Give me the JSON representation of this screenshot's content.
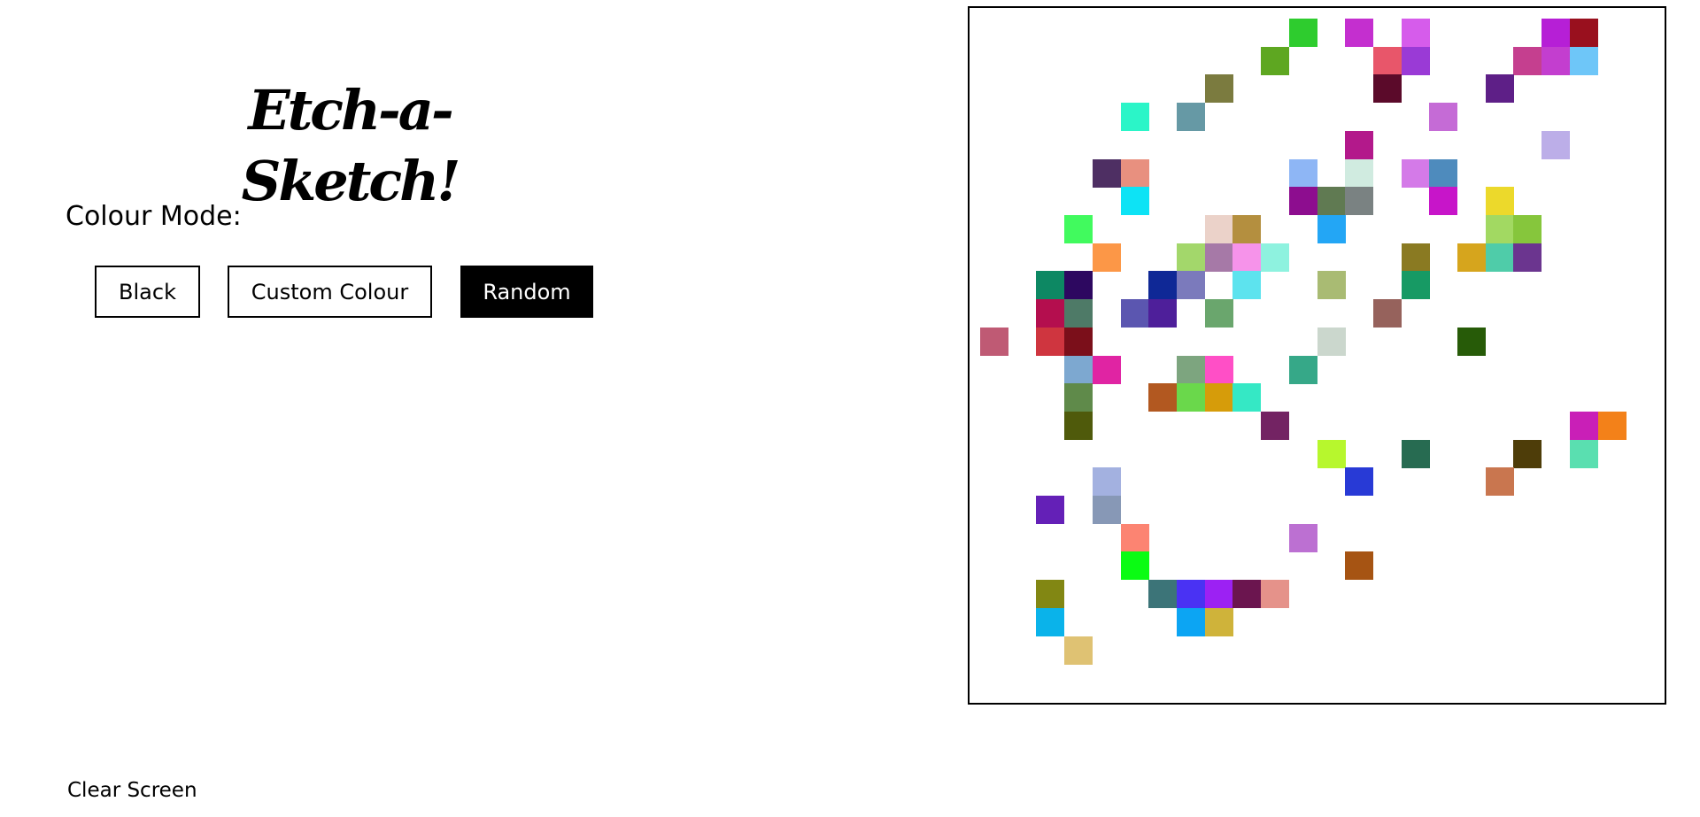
{
  "title": "Etch-a-Sketch!",
  "colour_mode": {
    "label": "Colour Mode:",
    "buttons": {
      "black": "Black",
      "custom": "Custom Colour",
      "random": "Random"
    },
    "selected": "Random"
  },
  "clear_label": "Clear Screen",
  "grid": {
    "columns": 24,
    "rows": 24,
    "filled_cells": [
      {
        "col": 11,
        "row": 0,
        "color": "#2ecc2e"
      },
      {
        "col": 13,
        "row": 0,
        "color": "#c42fcf"
      },
      {
        "col": 15,
        "row": 0,
        "color": "#d65ceb"
      },
      {
        "col": 20,
        "row": 0,
        "color": "#b61fd6"
      },
      {
        "col": 21,
        "row": 0,
        "color": "#99101e"
      },
      {
        "col": 10,
        "row": 1,
        "color": "#5ea721"
      },
      {
        "col": 14,
        "row": 1,
        "color": "#e8566a"
      },
      {
        "col": 15,
        "row": 1,
        "color": "#9a3ad6"
      },
      {
        "col": 19,
        "row": 1,
        "color": "#c53f8f"
      },
      {
        "col": 20,
        "row": 1,
        "color": "#c33ecf"
      },
      {
        "col": 21,
        "row": 1,
        "color": "#6ec6f8"
      },
      {
        "col": 8,
        "row": 2,
        "color": "#7b7b3f"
      },
      {
        "col": 14,
        "row": 2,
        "color": "#5b0a2a"
      },
      {
        "col": 18,
        "row": 2,
        "color": "#5e1f87"
      },
      {
        "col": 5,
        "row": 3,
        "color": "#2bf5c8"
      },
      {
        "col": 7,
        "row": 3,
        "color": "#6699a5"
      },
      {
        "col": 16,
        "row": 3,
        "color": "#c56bd6"
      },
      {
        "col": 13,
        "row": 4,
        "color": "#b3198b"
      },
      {
        "col": 20,
        "row": 4,
        "color": "#bcaee8"
      },
      {
        "col": 4,
        "row": 5,
        "color": "#4e2f63"
      },
      {
        "col": 5,
        "row": 5,
        "color": "#e8907f"
      },
      {
        "col": 11,
        "row": 5,
        "color": "#8eb6f5"
      },
      {
        "col": 13,
        "row": 5,
        "color": "#d0ebe0"
      },
      {
        "col": 15,
        "row": 5,
        "color": "#d47ae8"
      },
      {
        "col": 16,
        "row": 5,
        "color": "#4e8bbd"
      },
      {
        "col": 5,
        "row": 6,
        "color": "#0de3f5"
      },
      {
        "col": 11,
        "row": 6,
        "color": "#8d0d8f"
      },
      {
        "col": 12,
        "row": 6,
        "color": "#607a52"
      },
      {
        "col": 13,
        "row": 6,
        "color": "#7a8282"
      },
      {
        "col": 16,
        "row": 6,
        "color": "#c715c9"
      },
      {
        "col": 18,
        "row": 6,
        "color": "#ecd92b"
      },
      {
        "col": 3,
        "row": 7,
        "color": "#41fa5e"
      },
      {
        "col": 8,
        "row": 7,
        "color": "#ebd2c9"
      },
      {
        "col": 9,
        "row": 7,
        "color": "#b48f3f"
      },
      {
        "col": 12,
        "row": 7,
        "color": "#23a6f5"
      },
      {
        "col": 18,
        "row": 7,
        "color": "#a2d962"
      },
      {
        "col": 19,
        "row": 7,
        "color": "#86c63c"
      },
      {
        "col": 4,
        "row": 8,
        "color": "#fc9747"
      },
      {
        "col": 7,
        "row": 8,
        "color": "#a3d76b"
      },
      {
        "col": 8,
        "row": 8,
        "color": "#a679a7"
      },
      {
        "col": 9,
        "row": 8,
        "color": "#f693ea"
      },
      {
        "col": 10,
        "row": 8,
        "color": "#8ef2df"
      },
      {
        "col": 15,
        "row": 8,
        "color": "#8a7a22"
      },
      {
        "col": 17,
        "row": 8,
        "color": "#d6a51d"
      },
      {
        "col": 18,
        "row": 8,
        "color": "#4fcca9"
      },
      {
        "col": 19,
        "row": 8,
        "color": "#6b358f"
      },
      {
        "col": 2,
        "row": 9,
        "color": "#0d8863"
      },
      {
        "col": 3,
        "row": 9,
        "color": "#2d0860"
      },
      {
        "col": 6,
        "row": 9,
        "color": "#0f2896"
      },
      {
        "col": 7,
        "row": 9,
        "color": "#7b7abc"
      },
      {
        "col": 9,
        "row": 9,
        "color": "#5de3ee"
      },
      {
        "col": 12,
        "row": 9,
        "color": "#a9bb73"
      },
      {
        "col": 15,
        "row": 9,
        "color": "#179a64"
      },
      {
        "col": 2,
        "row": 10,
        "color": "#b40e4e"
      },
      {
        "col": 3,
        "row": 10,
        "color": "#4e7a67"
      },
      {
        "col": 5,
        "row": 10,
        "color": "#5b56b0"
      },
      {
        "col": 6,
        "row": 10,
        "color": "#4e1f9a"
      },
      {
        "col": 8,
        "row": 10,
        "color": "#6aa66d"
      },
      {
        "col": 14,
        "row": 10,
        "color": "#96625c"
      },
      {
        "col": 0,
        "row": 11,
        "color": "#bf5a74"
      },
      {
        "col": 2,
        "row": 11,
        "color": "#cf353f"
      },
      {
        "col": 3,
        "row": 11,
        "color": "#7b0f1a"
      },
      {
        "col": 12,
        "row": 11,
        "color": "#cbd7cd"
      },
      {
        "col": 17,
        "row": 11,
        "color": "#275b08"
      },
      {
        "col": 3,
        "row": 12,
        "color": "#7da8d0"
      },
      {
        "col": 4,
        "row": 12,
        "color": "#e024a3"
      },
      {
        "col": 7,
        "row": 12,
        "color": "#7da57f"
      },
      {
        "col": 8,
        "row": 12,
        "color": "#ff4fc6"
      },
      {
        "col": 11,
        "row": 12,
        "color": "#36a888"
      },
      {
        "col": 3,
        "row": 13,
        "color": "#5f8a4a"
      },
      {
        "col": 6,
        "row": 13,
        "color": "#b25820"
      },
      {
        "col": 7,
        "row": 13,
        "color": "#6ad84b"
      },
      {
        "col": 8,
        "row": 13,
        "color": "#d69c0a"
      },
      {
        "col": 9,
        "row": 13,
        "color": "#35e8c5"
      },
      {
        "col": 3,
        "row": 14,
        "color": "#4f5a0b"
      },
      {
        "col": 10,
        "row": 14,
        "color": "#732363"
      },
      {
        "col": 21,
        "row": 14,
        "color": "#c91fb7"
      },
      {
        "col": 22,
        "row": 14,
        "color": "#f38119"
      },
      {
        "col": 12,
        "row": 15,
        "color": "#b7f72d"
      },
      {
        "col": 15,
        "row": 15,
        "color": "#276b51"
      },
      {
        "col": 19,
        "row": 15,
        "color": "#4e3d09"
      },
      {
        "col": 21,
        "row": 15,
        "color": "#5adfb0"
      },
      {
        "col": 4,
        "row": 16,
        "color": "#a3b1e0"
      },
      {
        "col": 13,
        "row": 16,
        "color": "#283ad6"
      },
      {
        "col": 18,
        "row": 16,
        "color": "#c9764f"
      },
      {
        "col": 2,
        "row": 17,
        "color": "#6420b7"
      },
      {
        "col": 4,
        "row": 17,
        "color": "#8798b6"
      },
      {
        "col": 5,
        "row": 18,
        "color": "#fc8472"
      },
      {
        "col": 11,
        "row": 18,
        "color": "#bc70d2"
      },
      {
        "col": 5,
        "row": 19,
        "color": "#0afc13"
      },
      {
        "col": 13,
        "row": 19,
        "color": "#a65413"
      },
      {
        "col": 2,
        "row": 20,
        "color": "#828713"
      },
      {
        "col": 6,
        "row": 20,
        "color": "#3c7478"
      },
      {
        "col": 7,
        "row": 20,
        "color": "#4a32f3"
      },
      {
        "col": 8,
        "row": 20,
        "color": "#9c21f3"
      },
      {
        "col": 9,
        "row": 20,
        "color": "#6b154f"
      },
      {
        "col": 10,
        "row": 20,
        "color": "#e5928a"
      },
      {
        "col": 2,
        "row": 21,
        "color": "#0ab3ea"
      },
      {
        "col": 7,
        "row": 21,
        "color": "#0ca5f3"
      },
      {
        "col": 8,
        "row": 21,
        "color": "#cfb33a"
      },
      {
        "col": 3,
        "row": 22,
        "color": "#dfc273"
      }
    ]
  }
}
